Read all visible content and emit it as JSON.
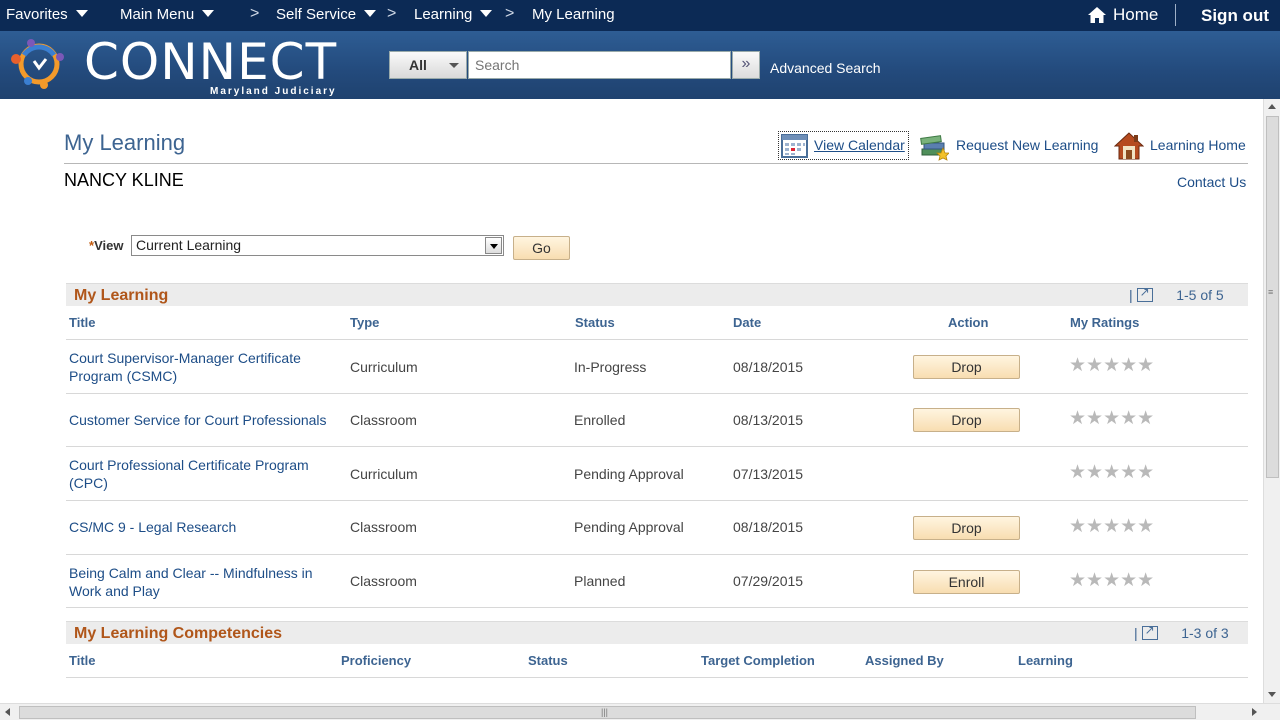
{
  "topnav": {
    "favorites": "Favorites",
    "main_menu": "Main Menu",
    "self_service": "Self Service",
    "learning": "Learning",
    "current": "My Learning",
    "separator": ">",
    "home": "Home",
    "sign_out": "Sign out"
  },
  "banner": {
    "logo_text": "CONNECT",
    "logo_sub": "Maryland Judiciary",
    "search_scope": "All",
    "search_placeholder": "Search",
    "search_go": "»",
    "advanced_search": "Advanced Search"
  },
  "page": {
    "title": "My Learning",
    "user": "NANCY KLINE",
    "links": {
      "view_calendar": "View Calendar",
      "request_new_learning": "Request New Learning",
      "learning_home": "Learning Home",
      "contact_us": "Contact Us"
    }
  },
  "filter": {
    "required_mark": "*",
    "view_label": "View",
    "view_value": "Current Learning",
    "go": "Go"
  },
  "my_learning": {
    "title": "My Learning",
    "pager": "1-5 of 5",
    "columns": {
      "title": "Title",
      "type": "Type",
      "status": "Status",
      "date": "Date",
      "action": "Action",
      "ratings": "My Ratings"
    },
    "rows": [
      {
        "title": "Court Supervisor-Manager Certificate Program (CSMC)",
        "type": "Curriculum",
        "status": "In-Progress",
        "date": "08/18/2015",
        "action": "Drop",
        "rating": "★★★★★"
      },
      {
        "title": "Customer Service for Court Professionals",
        "type": "Classroom",
        "status": "Enrolled",
        "date": "08/13/2015",
        "action": "Drop",
        "rating": "★★★★★"
      },
      {
        "title": "Court Professional Certificate Program (CPC)",
        "type": "Curriculum",
        "status": "Pending Approval",
        "date": "07/13/2015",
        "action": "",
        "rating": "★★★★★"
      },
      {
        "title": "CS/MC 9 - Legal Research",
        "type": "Classroom",
        "status": "Pending Approval",
        "date": "08/18/2015",
        "action": "Drop",
        "rating": "★★★★★"
      },
      {
        "title": "Being Calm and Clear -- Mindfulness in Work and Play",
        "type": "Classroom",
        "status": "Planned",
        "date": "07/29/2015",
        "action": "Enroll",
        "rating": "★★★★★"
      }
    ]
  },
  "competencies": {
    "title": "My Learning Competencies",
    "pager": "1-3 of 3",
    "columns": {
      "title": "Title",
      "proficiency": "Proficiency",
      "status": "Status",
      "target_completion": "Target Completion",
      "assigned_by": "Assigned By",
      "learning": "Learning"
    }
  },
  "icons": {
    "calendar": "calendar-icon",
    "request": "books-icon",
    "learning_home": "house-icon",
    "home": "home-icon",
    "zoom": "grid-zoom-icon"
  },
  "colors": {
    "nav_bg": "#0c2a55",
    "banner_bg": "#2e5d94",
    "section_title": "#b0561a",
    "link": "#1d4d87"
  }
}
